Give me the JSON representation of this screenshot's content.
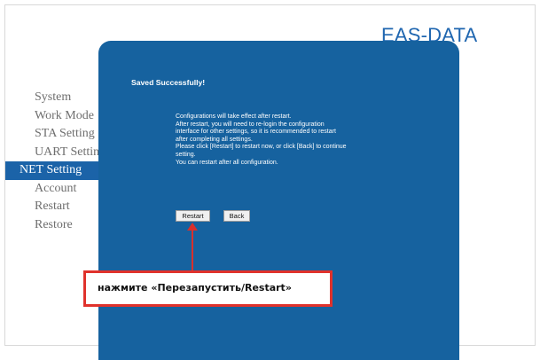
{
  "brand": "EAS-DATA",
  "sidebar": {
    "items": [
      {
        "label": "System"
      },
      {
        "label": "Work Mode"
      },
      {
        "label": "STA Setting"
      },
      {
        "label": "UART Setting"
      },
      {
        "label": "NET Setting",
        "active": true
      },
      {
        "label": "Account"
      },
      {
        "label": "Restart"
      },
      {
        "label": "Restore"
      }
    ]
  },
  "panel": {
    "saved_title": "Saved Successfully!",
    "message_lines": [
      "Configurations will take effect after restart.",
      "After restart, you will need to re-login the configuration",
      "interface for other settings, so it is recommended to restart",
      "after completing all settings.",
      "Please click [Restart] to restart now, or click [Back] to continue",
      "setting.",
      "You can restart after all configuration."
    ],
    "restart_label": "Restart",
    "back_label": "Back"
  },
  "annotation": {
    "text": "нажмите «Перезапустить/Restart»"
  },
  "colors": {
    "panel": "#16629f",
    "brand": "#1f66b0",
    "active_item": "#1b63a8",
    "callout_border": "#e0322c"
  }
}
